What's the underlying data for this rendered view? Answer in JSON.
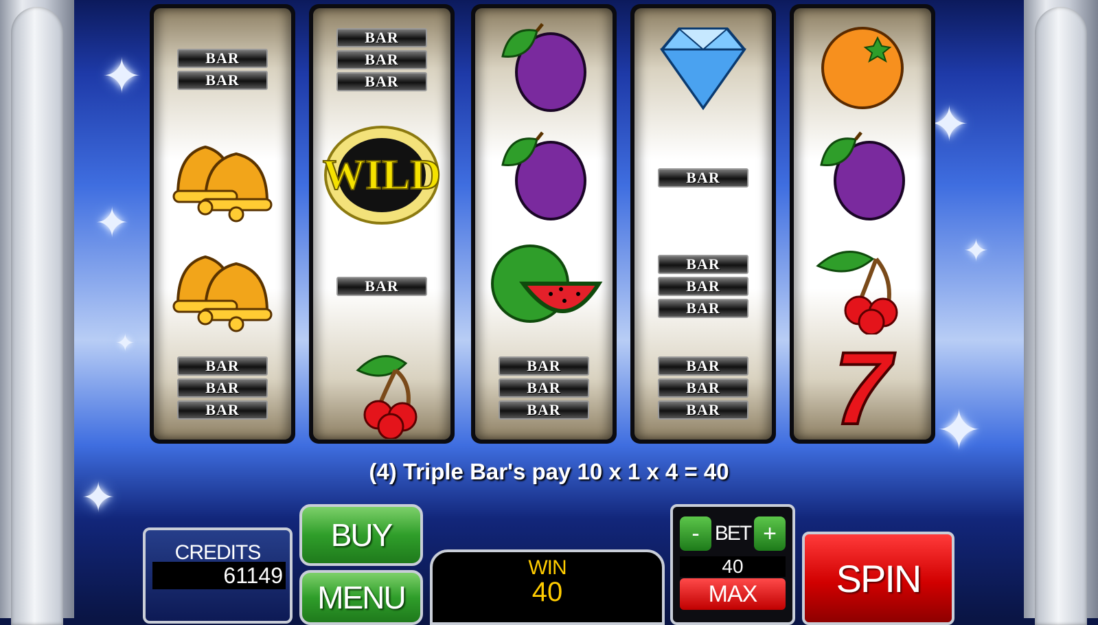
{
  "game": {
    "payline_message": "(4) Triple Bar's pay 10 x 1 x 4 = 40"
  },
  "reels": [
    {
      "symbols": [
        "double-bar",
        "bell",
        "bell",
        "triple-bar"
      ]
    },
    {
      "symbols": [
        "triple-bar",
        "wild",
        "single-bar",
        "cherry"
      ]
    },
    {
      "symbols": [
        "plum",
        "plum",
        "watermelon",
        "triple-bar"
      ]
    },
    {
      "symbols": [
        "diamond",
        "single-bar",
        "triple-bar",
        "triple-bar"
      ]
    },
    {
      "symbols": [
        "orange",
        "plum",
        "cherry",
        "seven"
      ]
    }
  ],
  "symbol_text": {
    "bar": "BAR",
    "wild": "WILD",
    "seven": "7"
  },
  "controls": {
    "credits_label": "CREDITS",
    "credits_value": "61149",
    "buy_label": "BUY",
    "menu_label": "MENU",
    "win_label": "WIN",
    "win_value": "40",
    "bet_minus": "-",
    "bet_label": "BET",
    "bet_plus": "+",
    "bet_value": "40",
    "max_label": "MAX",
    "spin_label": "SPIN"
  },
  "colors": {
    "backdrop_blue": "#3f6ee0",
    "spin_red": "#d10000",
    "button_green": "#2f9e2a",
    "win_yellow": "#ffcc00"
  }
}
